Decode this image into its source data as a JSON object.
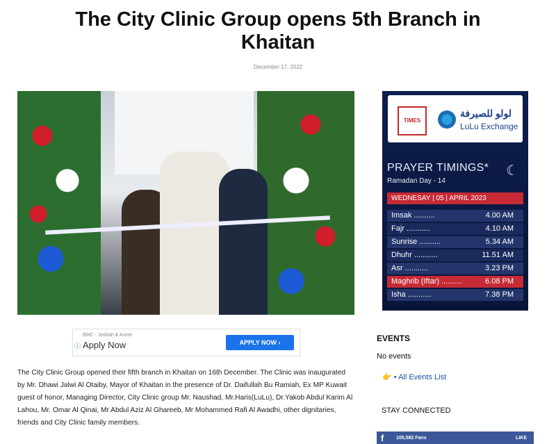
{
  "article": {
    "title": "The City Clinic Group opens 5th Branch in Khaitan",
    "date": "December 17, 2022",
    "body": "The City Clinic Group opened their fifth branch in Khaitan on 16th December. The Clinic was inaugurated by Mr. Dhawi Jalwi Al Otaiby, Mayor of Khaitan in the presence of Dr. Daifullah Bu Ramiah, Ex MP Kuwait guest of honor, Managing Director, City Clinic group Mr. Naushad, Mr.Haris(LuLu), Dr.Yakob Abdul Karim Al Lahou, Mr. Omar Al Qinai, Mr Abdul Aziz Al Ghareeb, Mr Mohammed Rafi Al Awadhi, other dignitaries, friends and City Clinic family members."
  },
  "ad": {
    "sponsor": "BMC - Jeddah & Aseer",
    "label": "Apply Now",
    "button": "APPLY NOW ›"
  },
  "prayer": {
    "times_logo": "TIMES",
    "lulu_arabic": "لولو للصيرفة",
    "lulu_english": "LuLu Exchange",
    "title": "PRAYER TIMINGS*",
    "subtitle": "Ramadan Day - 14",
    "date": "WEDNESAY | 05 | APRIL 2023",
    "rows": [
      {
        "name": "Imsak ..........",
        "time": "4.00 AM"
      },
      {
        "name": "Fajr ...........",
        "time": "4.10 AM"
      },
      {
        "name": "Sunrise ..........",
        "time": "5.34 AM"
      },
      {
        "name": "Dhuhr ...........",
        "time": "11.51 AM"
      },
      {
        "name": "Asr ...........",
        "time": "3.23 PM"
      },
      {
        "name": "Maghrib (Iftar) ..........",
        "time": "6.08 PM"
      },
      {
        "name": "Isha ...........",
        "time": "7.38 PM"
      }
    ]
  },
  "sidebar": {
    "events_heading": "EVENTS",
    "no_events": "No events",
    "all_events": "• All Events List",
    "stay_connected": "STAY CONNECTED",
    "fb_count": "105,582",
    "fb_label": "Fans",
    "fb_like": "LIKE"
  },
  "colors": {
    "highlight_row": "#c62a35",
    "row_dark": "#1b2a5c",
    "row_light": "#24356c",
    "facebook": "#3b5998",
    "ad_button": "#1a73e8"
  }
}
